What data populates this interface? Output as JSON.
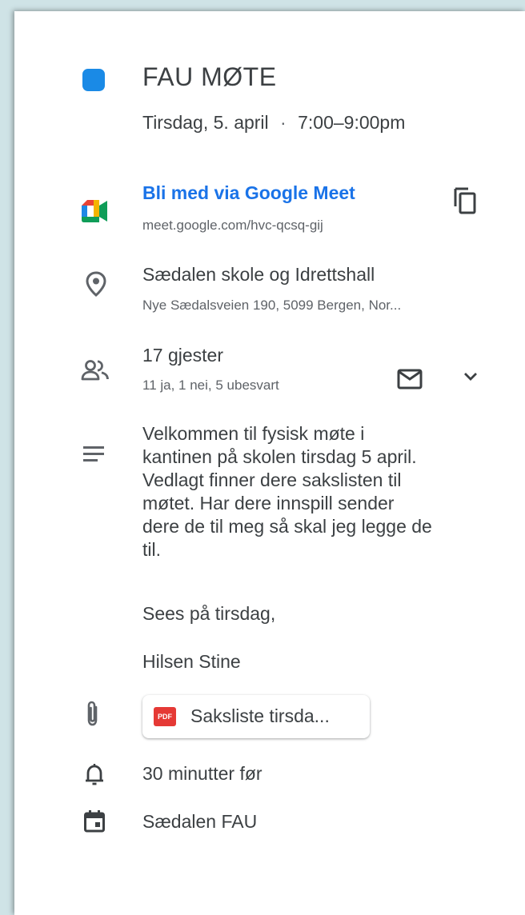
{
  "event": {
    "color": "#1a8ae6",
    "title": "FAU MØTE",
    "date": "Tirsdag, 5. april",
    "separator": "·",
    "time": "7:00–9:00pm"
  },
  "meet": {
    "join_label": "Bli med via Google Meet",
    "url": "meet.google.com/hvc-qcsq-gij",
    "icon": "google-meet-icon",
    "copy_icon": "copy-icon"
  },
  "location": {
    "name": "Sædalen skole og Idrettshall",
    "address": "Nye Sædalsveien 190, 5099 Bergen, Nor...",
    "icon": "location-pin-icon"
  },
  "guests": {
    "count_label": "17 gjester",
    "summary": "11 ja, 1 nei, 5 ubesvart",
    "icon": "people-icon",
    "email_icon": "email-icon",
    "expand_icon": "chevron-down-icon"
  },
  "description": {
    "icon": "notes-icon",
    "lines": [
      "Velkommen til fysisk møte i",
      "kantinen på skolen tirsdag 5 april.",
      "Vedlagt finner dere sakslisten til",
      "møtet.  Har dere innspill sender",
      "dere de til meg så skal jeg legge de",
      "til."
    ],
    "greeting": "Sees på tirsdag,",
    "signature": "Hilsen Stine"
  },
  "attachment": {
    "icon": "paperclip-icon",
    "badge": "PDF",
    "label": "Saksliste tirsda..."
  },
  "reminder": {
    "icon": "bell-icon",
    "label": "30 minutter før"
  },
  "calendar": {
    "icon": "calendar-icon",
    "label": "Sædalen FAU"
  }
}
